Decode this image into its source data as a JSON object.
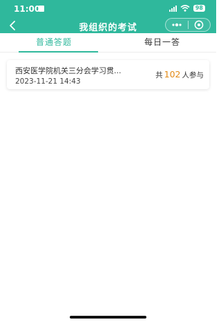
{
  "status_bar": {
    "time": "11:00",
    "battery": "98"
  },
  "nav": {
    "title": "我组织的考试"
  },
  "tabs": [
    {
      "label": "普通答题",
      "active": true
    },
    {
      "label": "每日一答",
      "active": false
    }
  ],
  "exams": [
    {
      "title": "西安医学院机关三分会学习贯...",
      "time": "2023-11-21 14:43",
      "participants_prefix": "共",
      "participants_count": "102",
      "participants_suffix": "人参与"
    }
  ],
  "colors": {
    "primary": "#2fb89c",
    "count_accent": "#e38a16"
  }
}
